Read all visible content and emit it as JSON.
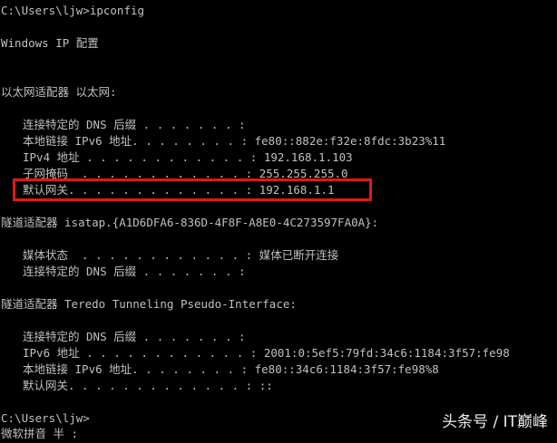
{
  "console": {
    "command_line": "C:\\Users\\ljw>ipconfig",
    "title": "Windows IP 配置",
    "ethernet": {
      "header": "以太网适配器 以太网:",
      "rows": [
        "连接特定的 DNS 后缀 . . . . . . . :",
        "本地链接 IPv6 地址. . . . . . . . : fe80::882e:f32e:8fdc:3b23%11",
        "IPv4 地址 . . . . . . . . . . . . : 192.168.1.103",
        "子网掩码  . . . . . . . . . . . . : 255.255.255.0",
        "默认网关. . . . . . . . . . . . . : 192.168.1.1"
      ]
    },
    "isatap": {
      "header": "隧道适配器 isatap.{A1D6DFA6-836D-4F8F-A8E0-4C273597FA0A}:",
      "rows": [
        "媒体状态  . . . . . . . . . . . . : 媒体已断开连接",
        "连接特定的 DNS 后缀 . . . . . . . :"
      ]
    },
    "teredo": {
      "header": "隧道适配器 Teredo Tunneling Pseudo-Interface:",
      "rows": [
        "连接特定的 DNS 后缀 . . . . . . . :",
        "IPv6 地址 . . . . . . . . . . . . : 2001:0:5ef5:79fd:34c6:1184:3f57:fe98",
        "本地链接 IPv6 地址. . . . . . . . : fe80::34c6:1184:3f57:fe98%8",
        "默认网关. . . . . . . . . . . . . : ::"
      ]
    },
    "prompt": "C:\\Users\\ljw>",
    "ime_status": "微软拼音 半 :"
  },
  "watermark": "头条号 / IT巅峰",
  "colors": {
    "background": "#000000",
    "text": "#c0c0c0",
    "highlight": "#e01818"
  }
}
